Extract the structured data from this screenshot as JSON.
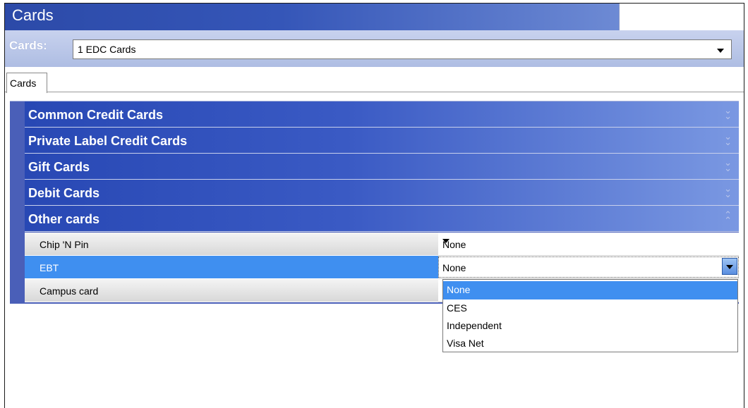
{
  "window": {
    "title": "Cards"
  },
  "selector": {
    "label": "Cards:",
    "value": "1 EDC Cards"
  },
  "tabs": [
    {
      "label": "Cards"
    }
  ],
  "sections": [
    {
      "label": "Common Credit Cards",
      "state": "collapsed"
    },
    {
      "label": "Private Label Credit Cards",
      "state": "collapsed"
    },
    {
      "label": "Gift Cards",
      "state": "collapsed"
    },
    {
      "label": "Debit Cards",
      "state": "collapsed"
    },
    {
      "label": "Other cards",
      "state": "expanded"
    }
  ],
  "other_cards_rows": [
    {
      "label": "Chip 'N Pin",
      "value": "None"
    },
    {
      "label": "EBT",
      "value": "None",
      "selected": true
    },
    {
      "label": "Campus card",
      "value": ""
    }
  ],
  "dropdown": {
    "options": [
      "None",
      "CES",
      "Independent",
      "Visa Net"
    ],
    "highlighted": "None"
  },
  "colors": {
    "section_header": "#3a5ac4",
    "selected_row": "#3f8ff0",
    "panel_background": "#4a5fb8"
  },
  "icons": {
    "collapsed": "double-chevron-down-icon",
    "expanded": "double-chevron-up-icon",
    "combo_arrow": "caret-down-icon"
  }
}
